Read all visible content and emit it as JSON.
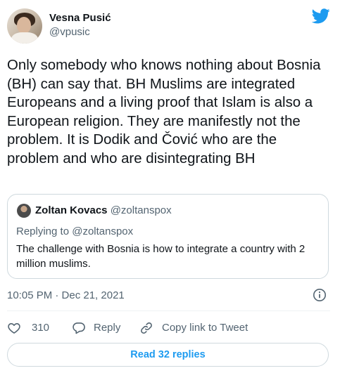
{
  "author": {
    "display_name": "Vesna Pusić",
    "handle": "@vpusic"
  },
  "tweet": {
    "text": "Only somebody who knows nothing about Bosnia (BH) can say that. BH Muslims are integrated Europeans and a living proof that Islam is also a European religion. They are manifestly not the problem. It is Dodik and Čović who are the problem and who are disintegrating BH",
    "timestamp": "10:05 PM · Dec 21, 2021"
  },
  "quoted_tweet": {
    "display_name": "Zoltan Kovacs",
    "handle": "@zoltanspox",
    "replying_to": "Replying to @zoltanspox",
    "text": "The challenge with Bosnia is how to integrate a country with 2 million muslims."
  },
  "actions": {
    "like_count": "310",
    "reply_label": "Reply",
    "copy_link_label": "Copy link to Tweet"
  },
  "read_replies_label": "Read 32 replies",
  "icons": {
    "brand": "twitter-bird-icon",
    "info": "info-icon",
    "like": "heart-icon",
    "reply": "reply-bubble-icon",
    "link": "link-icon"
  },
  "colors": {
    "twitter_blue": "#1d9bf0",
    "text_primary": "#0f1419",
    "text_secondary": "#536471",
    "border": "#cfd9de"
  }
}
